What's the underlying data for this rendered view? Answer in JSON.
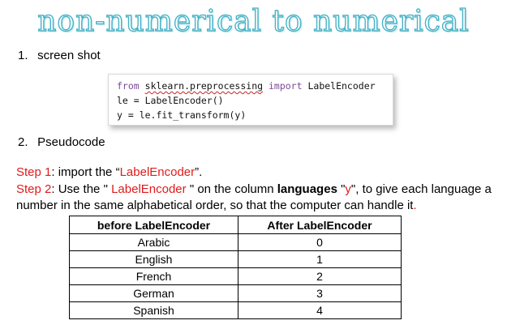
{
  "title": "non-numerical to numerical",
  "section1": {
    "number": "1.",
    "label": "screen shot"
  },
  "code": {
    "line1_kw1": "from",
    "line1_module": "sklearn.preprocessing",
    "line1_kw2": "import",
    "line1_name": "LabelEncoder",
    "line2": "le = LabelEncoder()",
    "line3": "y = le.fit_transform(y)"
  },
  "section2": {
    "number": "2.",
    "label": "Pseudocode"
  },
  "step1": {
    "label": "Step 1",
    "text_a": ": import the “",
    "highlight": "LabelEncoder",
    "text_b": "”."
  },
  "step2": {
    "label": "Step 2",
    "text_a": ": Use the \" ",
    "highlight": "LabelEncoder",
    "text_b": " \" on the column ",
    "bold": "languages",
    "text_c": " \"",
    "var": "y",
    "text_d": "\", to give each language a number in the same alphabetical order, so that the computer can handle it",
    "end": "."
  },
  "table": {
    "headers": [
      "before LabelEncoder",
      "After LabelEncoder"
    ],
    "rows": [
      [
        "Arabic",
        "0"
      ],
      [
        "English",
        "1"
      ],
      [
        "French",
        "2"
      ],
      [
        "German",
        "3"
      ],
      [
        "Spanish",
        "4"
      ]
    ]
  },
  "colors": {
    "accent_red": "#e01b1b",
    "title_teal": "#49b3c7"
  }
}
